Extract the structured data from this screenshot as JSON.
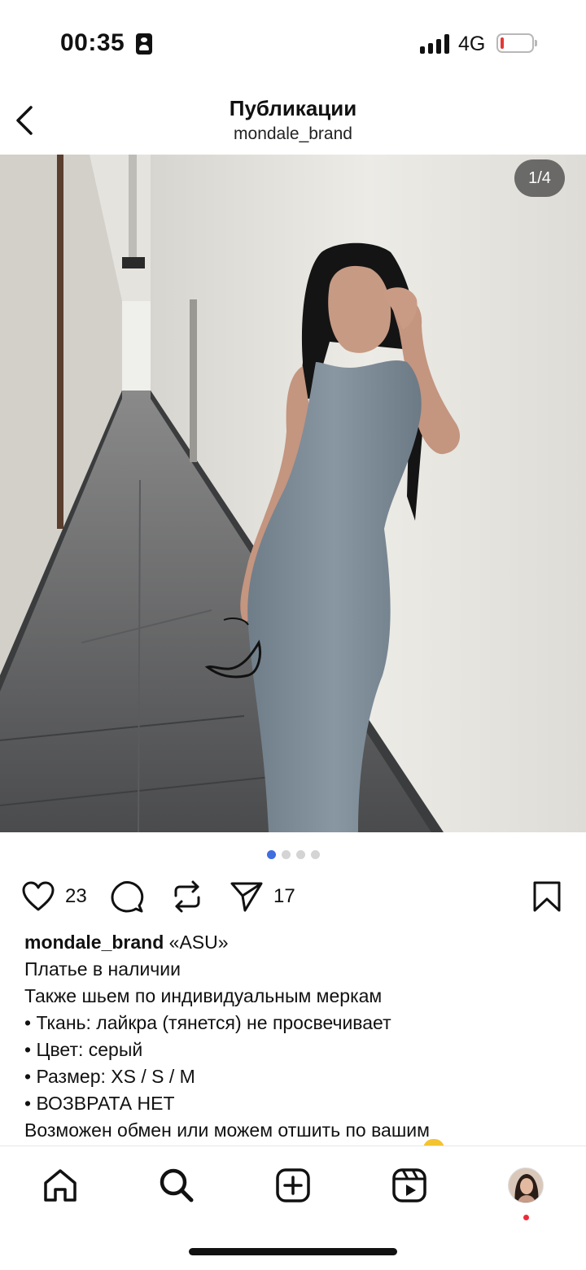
{
  "status_bar": {
    "time": "00:35",
    "network": "4G"
  },
  "header": {
    "title": "Публикации",
    "subtitle": "mondale_brand"
  },
  "post": {
    "image_counter": "1/4",
    "page_count": 4,
    "active_page": 1,
    "likes": "23",
    "shares": "17",
    "caption": {
      "username": "mondale_brand",
      "first_line_rest": " «ASU»",
      "lines": [
        "Платье в наличии",
        "Также шьем по индивидуальным меркам",
        "• Ткань: лайкра (тянется) не просвечивает",
        "• Цвет: серый",
        "• Размер: XS / S / M",
        "• ВОЗВРАТА  НЕТ",
        "Возможен обмен или можем отшить по вашим"
      ]
    }
  },
  "nav": {
    "items": [
      "home-icon",
      "search-icon",
      "create-icon",
      "reels-icon",
      "profile-avatar"
    ]
  },
  "colors": {
    "accent_dot": "#3f6ee0",
    "notification": "#ed2a3a",
    "dress": "#7d8b97"
  }
}
